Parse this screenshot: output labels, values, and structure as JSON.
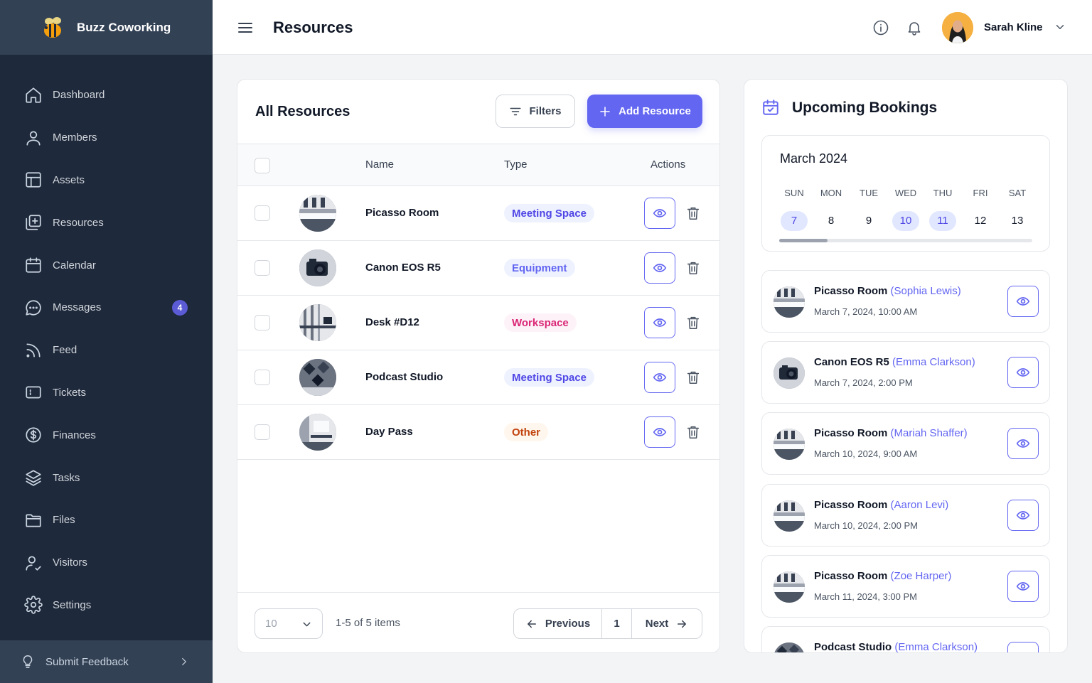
{
  "app": {
    "name": "Buzz Coworking"
  },
  "sidebar": {
    "items": [
      {
        "label": "Dashboard",
        "icon": "home-icon"
      },
      {
        "label": "Members",
        "icon": "user-icon"
      },
      {
        "label": "Assets",
        "icon": "layout-icon"
      },
      {
        "label": "Resources",
        "icon": "add-box-icon"
      },
      {
        "label": "Calendar",
        "icon": "calendar-icon"
      },
      {
        "label": "Messages",
        "icon": "chat-icon",
        "badge": "4"
      },
      {
        "label": "Feed",
        "icon": "rss-icon"
      },
      {
        "label": "Tickets",
        "icon": "ticket-icon"
      },
      {
        "label": "Finances",
        "icon": "dollar-icon"
      },
      {
        "label": "Tasks",
        "icon": "layers-icon"
      },
      {
        "label": "Files",
        "icon": "folder-icon"
      },
      {
        "label": "Visitors",
        "icon": "user-check-icon"
      },
      {
        "label": "Settings",
        "icon": "gear-icon"
      }
    ],
    "feedback_label": "Submit Feedback"
  },
  "header": {
    "title": "Resources",
    "user_name": "Sarah Kline"
  },
  "resources": {
    "title": "All Resources",
    "filters_label": "Filters",
    "add_label": "Add Resource",
    "columns": {
      "name": "Name",
      "type": "Type",
      "actions": "Actions"
    },
    "rows": [
      {
        "name": "Picasso Room",
        "type": "Meeting Space",
        "type_kind": "meeting",
        "thumb": "room"
      },
      {
        "name": "Canon EOS R5",
        "type": "Equipment",
        "type_kind": "equipment",
        "thumb": "camera"
      },
      {
        "name": "Desk #D12",
        "type": "Workspace",
        "type_kind": "workspace",
        "thumb": "desk"
      },
      {
        "name": "Podcast Studio",
        "type": "Meeting Space",
        "type_kind": "meeting",
        "thumb": "studio"
      },
      {
        "name": "Day Pass",
        "type": "Other",
        "type_kind": "other",
        "thumb": "office"
      }
    ],
    "page_size": "10",
    "items_count": "1-5 of 5 items",
    "prev_label": "Previous",
    "page": "1",
    "next_label": "Next"
  },
  "type_colors": {
    "meeting": {
      "bg": "#eef2ff",
      "fg": "#4f46e5"
    },
    "equipment": {
      "bg": "#eef2ff",
      "fg": "#6366f1"
    },
    "workspace": {
      "bg": "#fdf2f8",
      "fg": "#db2777"
    },
    "other": {
      "bg": "#fff7ed",
      "fg": "#c2410c"
    }
  },
  "bookings": {
    "title": "Upcoming Bookings",
    "month": "March 2024",
    "weekdays": [
      "SUN",
      "MON",
      "TUE",
      "WED",
      "THU",
      "FRI",
      "SAT"
    ],
    "days": [
      {
        "d": "7",
        "hl": true
      },
      {
        "d": "8",
        "hl": false
      },
      {
        "d": "9",
        "hl": false
      },
      {
        "d": "10",
        "hl": true
      },
      {
        "d": "11",
        "hl": true
      },
      {
        "d": "12",
        "hl": false
      },
      {
        "d": "13",
        "hl": false
      }
    ],
    "items": [
      {
        "resource": "Picasso Room",
        "person": "(Sophia Lewis)",
        "when": "March 7, 2024, 10:00 AM",
        "thumb": "room"
      },
      {
        "resource": "Canon EOS R5",
        "person": "(Emma Clarkson)",
        "when": "March 7, 2024, 2:00 PM",
        "thumb": "camera"
      },
      {
        "resource": "Picasso Room",
        "person": "(Mariah Shaffer)",
        "when": "March 10, 2024, 9:00 AM",
        "thumb": "room"
      },
      {
        "resource": "Picasso Room",
        "person": "(Aaron Levi)",
        "when": "March 10, 2024, 2:00 PM",
        "thumb": "room"
      },
      {
        "resource": "Picasso Room",
        "person": "(Zoe Harper)",
        "when": "March 11, 2024, 3:00 PM",
        "thumb": "room"
      },
      {
        "resource": "Podcast Studio",
        "person": "(Emma Clarkson)",
        "when": "",
        "thumb": "studio"
      }
    ]
  }
}
